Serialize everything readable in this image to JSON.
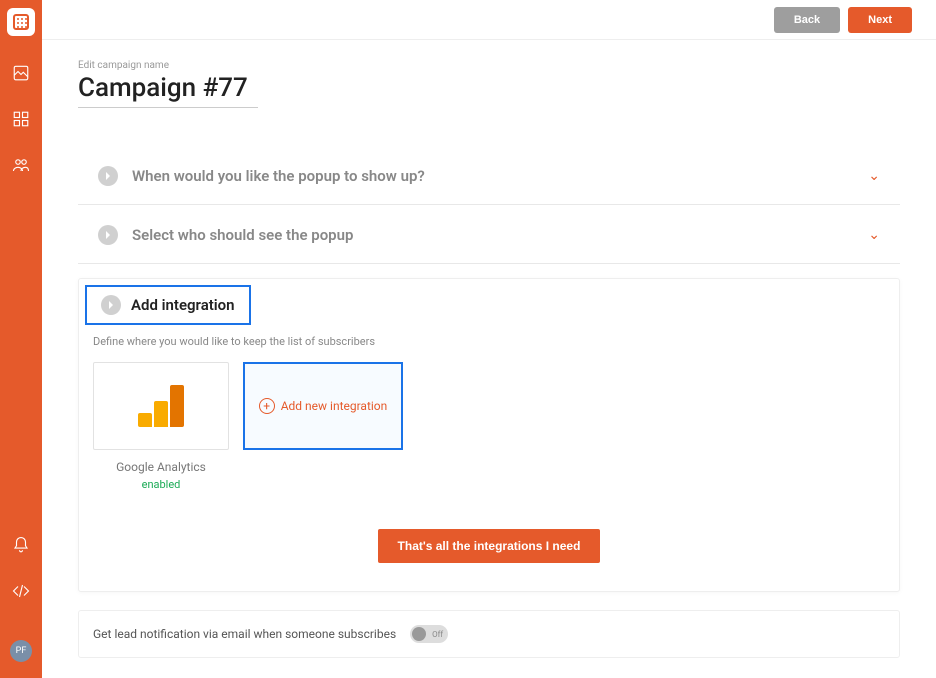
{
  "topbar": {
    "back": "Back",
    "next": "Next"
  },
  "campaign": {
    "edit_label": "Edit campaign name",
    "title": "Campaign #77"
  },
  "accordion": {
    "when": "When would you like the popup to show up?",
    "who": "Select who should see the popup"
  },
  "integration": {
    "heading": "Add integration",
    "subtext": "Define where you would like to keep the list of subscribers",
    "ga_name": "Google Analytics",
    "ga_status": "enabled",
    "add_new": "Add new integration",
    "confirm": "That's all the integrations I need"
  },
  "notification": {
    "text": "Get lead notification via email when someone subscribes",
    "toggle": "Off"
  },
  "avatar": "PF"
}
